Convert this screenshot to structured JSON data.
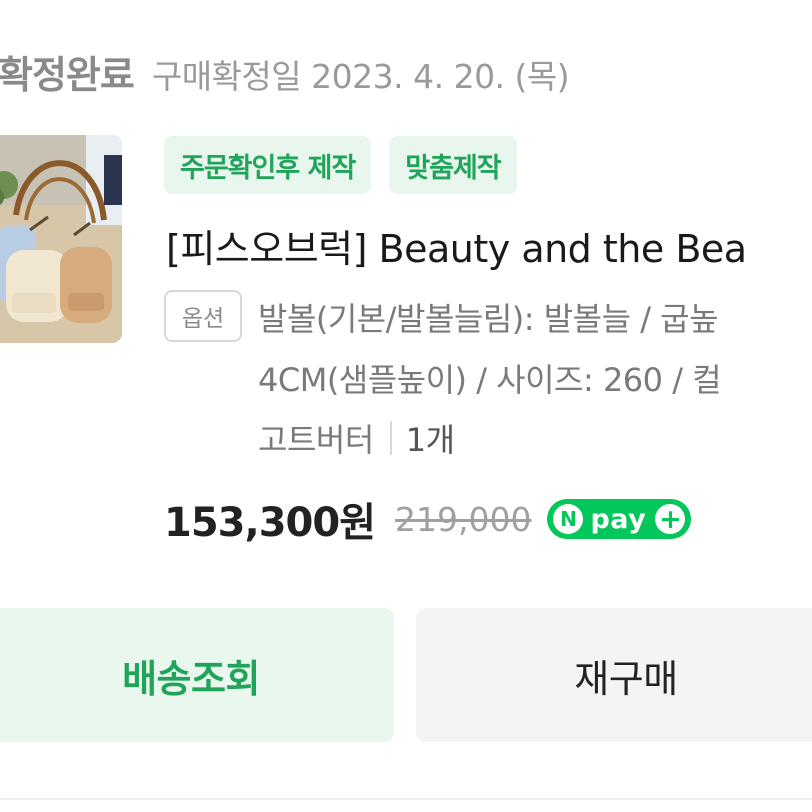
{
  "order": {
    "status": "확정완료",
    "confirm_label": "구매확정일 2023. 4. 20. (목)"
  },
  "product": {
    "badges": [
      "주문확인후 제작",
      "맞춤제작"
    ],
    "title": "[피스오브럭] Beauty and the Bea",
    "option_tag": "옵션",
    "option_lines": [
      "발볼(기본/발볼늘림): 발볼늘 / 굽높",
      "4CM(샘플높이) / 사이즈: 260 / 컬",
      "고트버터"
    ],
    "quantity": "1개",
    "price": "153,300원",
    "original_price": "219,000",
    "npay": {
      "n": "N",
      "label": "pay",
      "plus": "+"
    }
  },
  "actions": {
    "delivery_label": "배송조회",
    "reorder_label": "재구매"
  },
  "colors": {
    "accent_green": "#1fa45a",
    "badge_bg": "#e8f6ee",
    "npay_green": "#03c75a"
  }
}
